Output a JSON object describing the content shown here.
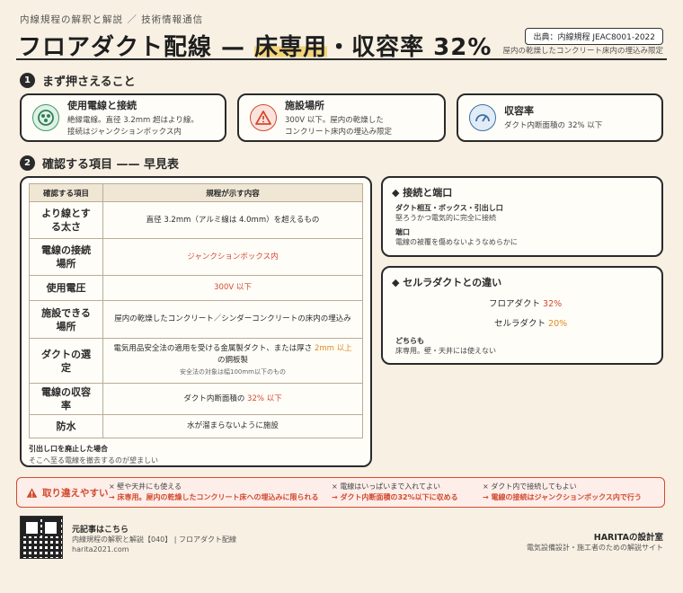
{
  "header": {
    "subtitle": "内線規程の解釈と解説 ／ 技術情報通信",
    "title_a": "フロアダクト配線 — ",
    "title_b": "床専用",
    "title_c": "・収容率 32%",
    "source": "出典：内線規程 JEAC8001-2022",
    "source_note": "屋内の乾燥したコンクリート床内の埋込み限定"
  },
  "section1": {
    "num": "1",
    "title": "まず押さえること"
  },
  "points": [
    {
      "title": "使用電線と接続",
      "line1": "絶縁電線。直径 3.2mm 超はより線。",
      "line2": "接続はジャンクションボックス内"
    },
    {
      "title": "施設場所",
      "line1": "300V 以下。屋内の乾燥した",
      "line2": "コンクリート床内の埋込み限定"
    },
    {
      "title": "収容率",
      "line1": "ダクト内断面積の 32% 以下",
      "line2": ""
    }
  ],
  "section2": {
    "num": "2",
    "title": "確認する項目 —— 早見表"
  },
  "table": {
    "headers": [
      "確認する項目",
      "規程が示す内容"
    ],
    "rows": [
      {
        "k": "より線とする太さ",
        "v": "直径 3.2mm（アルミ線は 4.0mm）を超えるもの",
        "note": ""
      },
      {
        "k": "電線の接続場所",
        "v": "ジャンクションボックス内",
        "note": ""
      },
      {
        "k": "使用電圧",
        "v": "300V 以下",
        "note": ""
      },
      {
        "k": "施設できる場所",
        "v": "屋内の乾燥したコンクリート／シンダーコンクリートの床内の埋込み",
        "note": ""
      },
      {
        "k": "ダクトの選定",
        "v_a": "電気用品安全法の適用を受ける金属製ダクト、または厚さ ",
        "v_b": "2mm 以上",
        "v_c": " の鋼板製",
        "note": "安全法の対象は幅100mm以下のもの"
      },
      {
        "k": "電線の収容率",
        "v_a": "ダクト内断面積の ",
        "v_b": "32% 以下",
        "note": ""
      },
      {
        "k": "防水",
        "v": "水が溜まらないように施設",
        "note": ""
      }
    ],
    "foot_title": "引出し口を廃止した場合",
    "foot_text": "そこへ至る電線を撤去するのが望ましい"
  },
  "side1": {
    "title": "接続と端口",
    "b1": "ダクト相互・ボックス・引出し口",
    "t1": "堅ろうかつ電気的に完全に接続",
    "b2": "端口",
    "t2": "電線の被覆を傷めないようなめらかに"
  },
  "side2": {
    "title": "セルラダクトとの違い",
    "r1_label": "フロアダクト",
    "r1_val": "32%",
    "r2_label": "セルラダクト",
    "r2_val": "20%",
    "b": "どちらも",
    "t": "床専用。壁・天井には使えない"
  },
  "warning": {
    "tag": "取り違えやすい",
    "items": [
      {
        "x": "× 壁や天井にも使える",
        "a": "→ 床専用。屋内の乾燥したコンクリート床への埋込みに限られる"
      },
      {
        "x": "× 電線はいっぱいまで入れてよい",
        "a": "→ ダクト内断面積の32%以下に収める"
      },
      {
        "x": "× ダクト内で接続してもよい",
        "a": "→ 電線の接続はジャンクションボックス内で行う"
      }
    ]
  },
  "footer": {
    "label": "元記事はこちら",
    "article": "内線規程の解釈と解説【040】 | フロアダクト配線",
    "url": "harita2021.com",
    "brand": "HARITAの設計室",
    "brand_sub": "電気設備設計・施工者のための解説サイト"
  },
  "colors": {
    "accent": "#d24a2e",
    "highlight": "#f5d57a",
    "ink": "#2a2a2a"
  }
}
